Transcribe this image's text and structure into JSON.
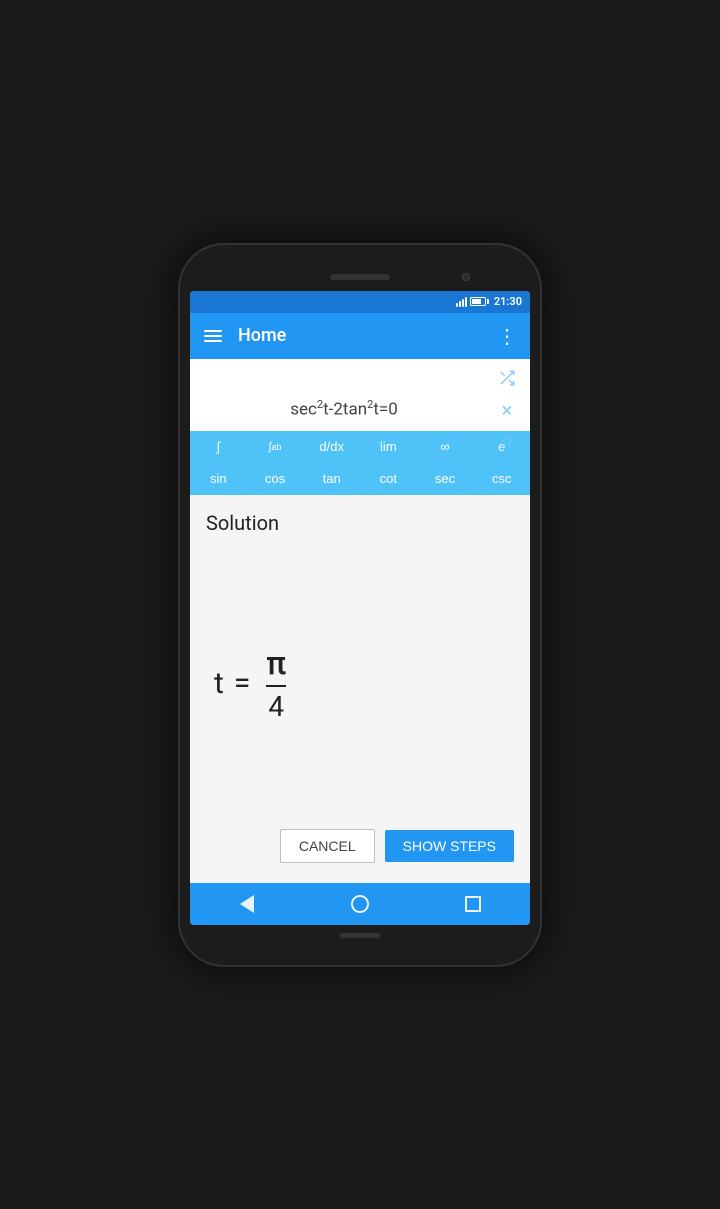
{
  "phone": {
    "status_bar": {
      "time": "21:30",
      "signal_bars": [
        4,
        6,
        8,
        10,
        12
      ],
      "battery_level": 80
    },
    "app_bar": {
      "title": "Home",
      "hamburger_label": "menu",
      "more_label": "more"
    },
    "formula": {
      "expression": "sec²t-2tan²t=0"
    },
    "action_icons": {
      "shuffle": "⇌",
      "close": "×",
      "star": "☆"
    },
    "keyboard": {
      "row1": [
        "∫",
        "∫ₐᵇ",
        "d/dx",
        "lim",
        "∞",
        "e"
      ],
      "row2": [
        "sin",
        "cos",
        "tan",
        "cot",
        "sec",
        "csc"
      ]
    },
    "solution": {
      "label": "Solution",
      "variable": "t",
      "equals": "=",
      "numerator": "π",
      "denominator": "4"
    },
    "buttons": {
      "cancel": "Cancel",
      "show_steps": "Show steps"
    },
    "bottom_nav": {
      "back": "◁",
      "home": "○",
      "recents": "□"
    }
  }
}
